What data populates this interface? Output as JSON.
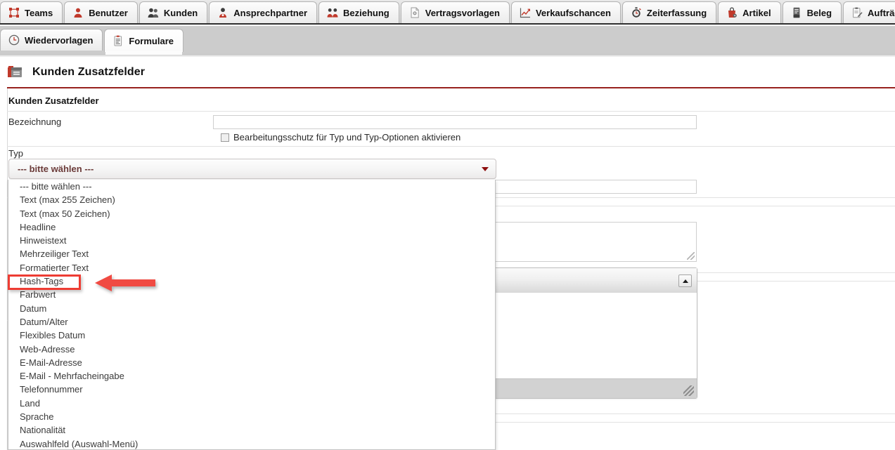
{
  "window": {
    "tab_rows": [
      {
        "tabs": [
          {
            "label": "Teams",
            "icon": "teams-icon",
            "active": false
          },
          {
            "label": "Benutzer",
            "icon": "user-icon",
            "active": false
          },
          {
            "label": "Kunden",
            "icon": "customers-icon",
            "active": false
          },
          {
            "label": "Ansprechpartner",
            "icon": "contact-person-icon",
            "active": false
          },
          {
            "label": "Beziehung",
            "icon": "relationship-icon",
            "active": false
          },
          {
            "label": "Vertragsvorlagen",
            "icon": "contract-template-icon",
            "active": false
          },
          {
            "label": "Verkaufschancen",
            "icon": "sales-chart-icon",
            "active": false
          },
          {
            "label": "Zeiterfassung",
            "icon": "stopwatch-icon",
            "active": false
          },
          {
            "label": "Artikel",
            "icon": "article-bag-icon",
            "active": false
          },
          {
            "label": "Beleg",
            "icon": "receipt-icon",
            "active": false
          },
          {
            "label": "Aufträge",
            "icon": "orders-clipboard-icon",
            "active": false
          }
        ]
      },
      {
        "tabs": [
          {
            "label": "Wiedervorlagen",
            "icon": "clock-icon",
            "active": false
          },
          {
            "label": "Formulare",
            "icon": "form-clipboard-icon",
            "active": true
          }
        ]
      }
    ]
  },
  "page": {
    "icon": "card-file-icon",
    "title": "Kunden Zusatzfelder",
    "rule_color": "#98221e"
  },
  "form": {
    "section_title": "Kunden Zusatzfelder",
    "bezeichnung": {
      "label": "Bezeichnung",
      "value": "",
      "placeholder": ""
    },
    "edit_protection": {
      "label": "Bearbeitungsschutz für Typ und Typ-Optionen aktivieren",
      "checked": false
    },
    "typ": {
      "label": "Typ",
      "selected": "--- bitte wählen ---",
      "expanded": true,
      "options": [
        "--- bitte wählen ---",
        "Text (max 255 Zeichen)",
        "Text (max 50 Zeichen)",
        "Headline",
        "Hinweistext",
        "Mehrzeiliger Text",
        "Formatierter Text",
        "Hash-Tags",
        "Farbwert",
        "Datum",
        "Datum/Alter",
        "Flexibles Datum",
        "Web-Adresse",
        "E-Mail-Adresse",
        "E-Mail - Mehrfacheingabe",
        "Telefonnummer",
        "Land",
        "Sprache",
        "Nationalität",
        "Auswahlfeld (Auswahl-Menü)"
      ],
      "highlighted_option": "Hash-Tags"
    },
    "hidden_field_2": {
      "value": ""
    },
    "hidden_textarea": {
      "value": ""
    },
    "rich_editor": {
      "value": ""
    }
  },
  "annotations": {
    "highlight_color": "#ee3c33",
    "arrow_color": "#f04a42",
    "arrow_direction": "left",
    "target": "Hash-Tags"
  }
}
